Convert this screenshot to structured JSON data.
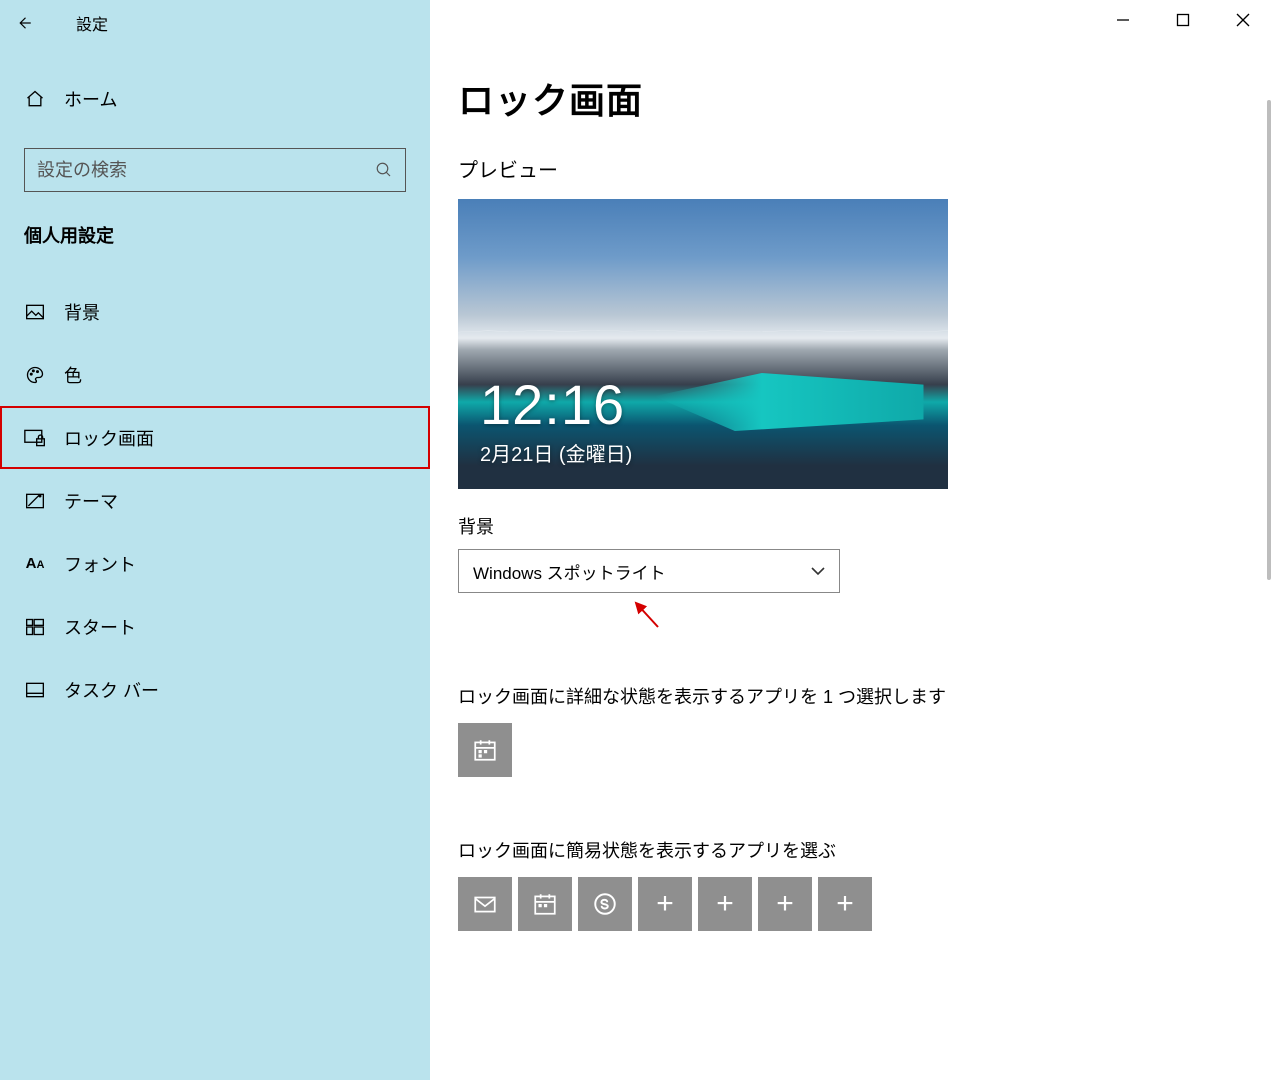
{
  "window": {
    "title": "設定"
  },
  "sidebar": {
    "home": "ホーム",
    "search_placeholder": "設定の検索",
    "section": "個人用設定",
    "items": [
      {
        "label": "背景",
        "icon": "image-icon"
      },
      {
        "label": "色",
        "icon": "palette-icon"
      },
      {
        "label": "ロック画面",
        "icon": "lockscreen-icon",
        "selected": true
      },
      {
        "label": "テーマ",
        "icon": "theme-icon"
      },
      {
        "label": "フォント",
        "icon": "font-icon"
      },
      {
        "label": "スタート",
        "icon": "start-icon"
      },
      {
        "label": "タスク バー",
        "icon": "taskbar-icon"
      }
    ]
  },
  "page": {
    "title": "ロック画面",
    "preview_heading": "プレビュー",
    "preview": {
      "time": "12:16",
      "date": "2月21日 (金曜日)"
    },
    "background_label": "背景",
    "background_value": "Windows スポットライト",
    "detailed_status_label": "ロック画面に詳細な状態を表示するアプリを 1 つ選択します",
    "quick_status_label": "ロック画面に簡易状態を表示するアプリを選ぶ",
    "detailed_apps": [
      {
        "icon": "calendar-icon"
      }
    ],
    "quick_apps": [
      {
        "icon": "mail-icon"
      },
      {
        "icon": "calendar-icon"
      },
      {
        "icon": "skype-icon"
      },
      {
        "icon": "plus-icon"
      },
      {
        "icon": "plus-icon"
      },
      {
        "icon": "plus-icon"
      },
      {
        "icon": "plus-icon"
      }
    ]
  }
}
